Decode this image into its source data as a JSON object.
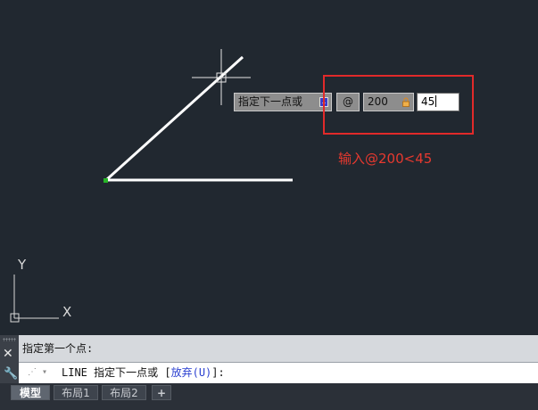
{
  "drawing": {
    "dynamic_input": {
      "prompt": "指定下一点或",
      "relative_symbol": "@",
      "length_value": "200",
      "angle_value": "45"
    },
    "annotation": "输入@200<45",
    "ucs": {
      "y_label": "Y",
      "x_label": "X"
    }
  },
  "command_line": {
    "history": "指定第一个点:",
    "input_prefix": "LINE 指定下一点或 [",
    "option_label": "放弃(",
    "option_key": "U",
    "option_close": ")",
    "input_suffix": "]:"
  },
  "layout_tabs": [
    {
      "label": "模型",
      "active": true
    },
    {
      "label": "布局1",
      "active": false
    },
    {
      "label": "布局2",
      "active": false
    },
    {
      "label": "+",
      "active": false
    }
  ],
  "colors": {
    "background": "#212830",
    "highlight": "#e12a2a",
    "annotation": "#e6392f"
  }
}
